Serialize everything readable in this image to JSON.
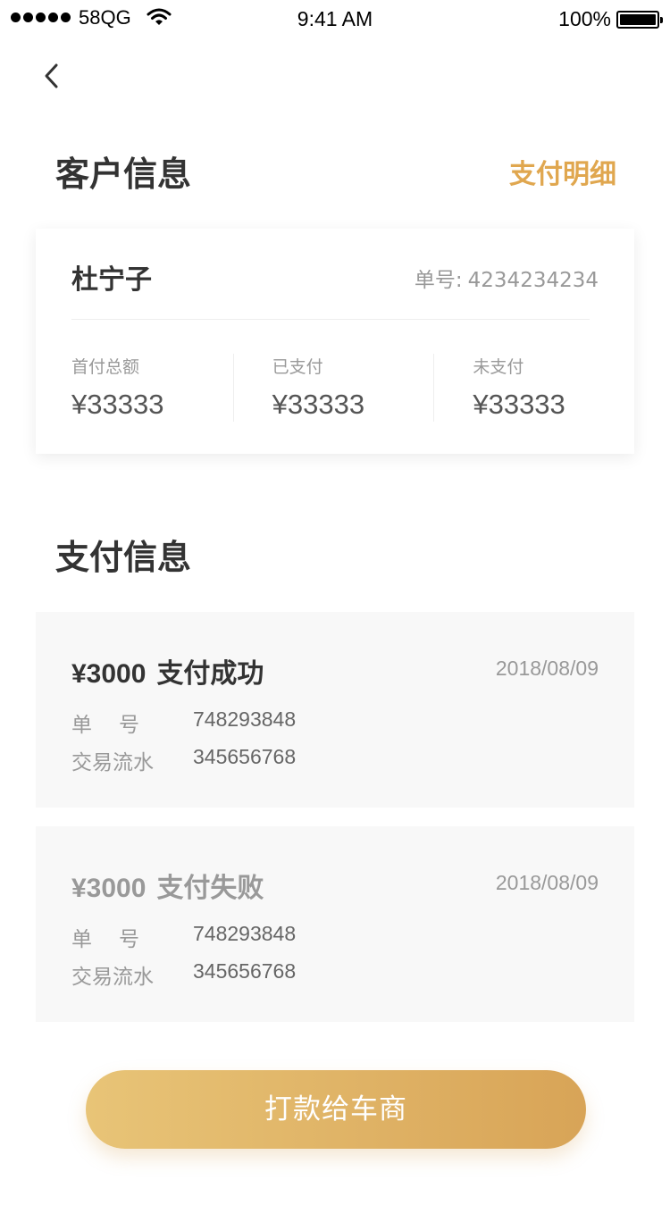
{
  "status_bar": {
    "carrier": "58QG",
    "time": "9:41 AM",
    "battery": "100%"
  },
  "customer_section": {
    "title": "客户信息",
    "detail_link": "支付明细",
    "name": "杜宁子",
    "order_label": "单号:",
    "order_value": "4234234234",
    "stats": [
      {
        "label": "首付总额",
        "value": "¥33333"
      },
      {
        "label": "已支付",
        "value": "¥33333"
      },
      {
        "label": "未支付",
        "value": "¥33333"
      }
    ]
  },
  "payment_section": {
    "title": "支付信息",
    "records": [
      {
        "amount": "¥3000",
        "status": "支付成功",
        "date": "2018/08/09",
        "order_label": "单号",
        "order_value": "748293848",
        "serial_label": "交易流水",
        "serial_value": "345656768"
      },
      {
        "amount": "¥3000",
        "status": "支付失败",
        "date": "2018/08/09",
        "order_label": "单号",
        "order_value": "748293848",
        "serial_label": "交易流水",
        "serial_value": "345656768"
      }
    ]
  },
  "action_button": "打款给车商",
  "colors": {
    "accent": "#e0a74f",
    "button_start": "#e8c477",
    "button_end": "#d8a457"
  }
}
